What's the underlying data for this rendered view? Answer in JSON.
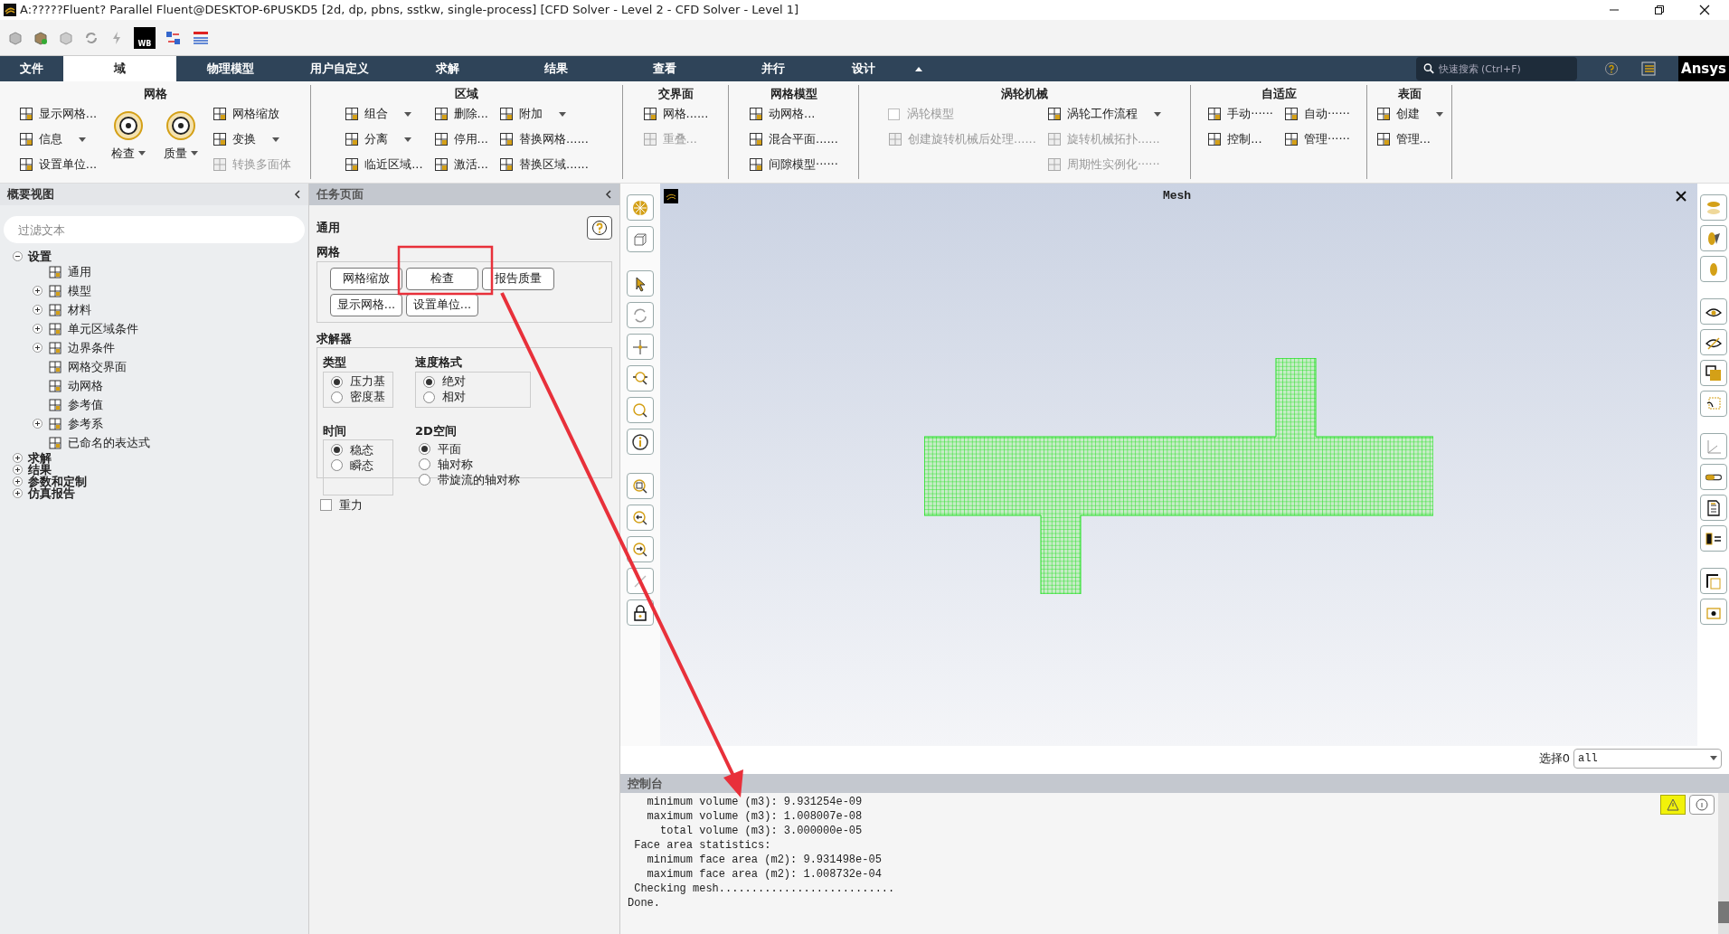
{
  "window": {
    "title": "A:?????Fluent? Parallel Fluent@DESKTOP-6PUSKD5  [2d, dp, pbns, sstkw, single-process] [CFD Solver - Level 2 - CFD Solver - Level 1]"
  },
  "quick_toolbar": {
    "wb_label": "WB"
  },
  "tabs": [
    {
      "label": "文件",
      "selected": false
    },
    {
      "label": "域",
      "selected": true
    },
    {
      "label": "物理模型",
      "selected": false
    },
    {
      "label": "用户自定义",
      "selected": false
    },
    {
      "label": "求解",
      "selected": false
    },
    {
      "label": "结果",
      "selected": false
    },
    {
      "label": "查看",
      "selected": false
    },
    {
      "label": "并行",
      "selected": false
    },
    {
      "label": "设计",
      "selected": false
    }
  ],
  "search": {
    "placeholder": "快速搜索 (Ctrl+F)"
  },
  "brand": "Ansys",
  "ribbon": [
    {
      "title": "网格",
      "columns": [
        [
          {
            "kind": "button",
            "label": "显示网格...",
            "disabled": false,
            "dropdown": false
          },
          {
            "kind": "button",
            "label": "信息",
            "disabled": false,
            "dropdown": true
          },
          {
            "kind": "button",
            "label": "设置单位...",
            "disabled": false,
            "dropdown": false
          }
        ],
        [
          {
            "kind": "large",
            "label": "检查",
            "disabled": false,
            "dropdown": true
          }
        ],
        [
          {
            "kind": "large",
            "label": "质量",
            "disabled": false,
            "dropdown": true
          }
        ],
        [
          {
            "kind": "button",
            "label": "网格缩放",
            "disabled": false,
            "dropdown": false
          },
          {
            "kind": "button",
            "label": "变换",
            "disabled": false,
            "dropdown": true
          },
          {
            "kind": "button",
            "label": "转换多面体",
            "disabled": true,
            "dropdown": false
          }
        ]
      ]
    },
    {
      "title": "区域",
      "columns": [
        [
          {
            "kind": "button",
            "label": "组合",
            "disabled": false,
            "dropdown": true
          },
          {
            "kind": "button",
            "label": "分离",
            "disabled": false,
            "dropdown": true
          },
          {
            "kind": "button",
            "label": "临近区域...",
            "disabled": false,
            "dropdown": false
          }
        ],
        [
          {
            "kind": "button",
            "label": "删除...",
            "disabled": false,
            "dropdown": false
          },
          {
            "kind": "button",
            "label": "停用...",
            "disabled": false,
            "dropdown": false
          },
          {
            "kind": "button",
            "label": "激活...",
            "disabled": false,
            "dropdown": false
          }
        ],
        [
          {
            "kind": "button",
            "label": "附加",
            "disabled": false,
            "dropdown": true
          },
          {
            "kind": "button",
            "label": "替换网格......",
            "disabled": false,
            "dropdown": false
          },
          {
            "kind": "button",
            "label": "替换区域......",
            "disabled": false,
            "dropdown": false
          }
        ]
      ]
    },
    {
      "title": "交界面",
      "columns": [
        [
          {
            "kind": "button",
            "label": "网格......",
            "disabled": false,
            "dropdown": false
          },
          {
            "kind": "button",
            "label": "重叠...",
            "disabled": true,
            "dropdown": false
          }
        ]
      ]
    },
    {
      "title": "网格模型",
      "columns": [
        [
          {
            "kind": "button",
            "label": "动网格...",
            "disabled": false,
            "dropdown": false
          },
          {
            "kind": "button",
            "label": "混合平面......",
            "disabled": false,
            "dropdown": false
          },
          {
            "kind": "button",
            "label": "间隙模型······",
            "disabled": false,
            "dropdown": false
          }
        ]
      ]
    },
    {
      "title": "涡轮机械",
      "columns": [
        [
          {
            "kind": "checkbox",
            "label": "涡轮模型",
            "disabled": true,
            "checked": false
          },
          {
            "kind": "button",
            "label": "创建旋转机械后处理......",
            "disabled": true,
            "dropdown": false
          }
        ],
        [
          {
            "kind": "button",
            "label": "涡轮工作流程",
            "disabled": false,
            "dropdown": true
          },
          {
            "kind": "button",
            "label": "旋转机械拓扑......",
            "disabled": true,
            "dropdown": false
          },
          {
            "kind": "button",
            "label": "周期性实例化······",
            "disabled": true,
            "dropdown": false
          }
        ]
      ]
    },
    {
      "title": "自适应",
      "columns": [
        [
          {
            "kind": "button",
            "label": "手动······",
            "disabled": false,
            "dropdown": false
          },
          {
            "kind": "button",
            "label": "控制...",
            "disabled": false,
            "dropdown": false
          }
        ],
        [
          {
            "kind": "button",
            "label": "自动······",
            "disabled": false,
            "dropdown": false
          },
          {
            "kind": "button",
            "label": "管理······",
            "disabled": false,
            "dropdown": false
          }
        ]
      ]
    },
    {
      "title": "表面",
      "columns": [
        [
          {
            "kind": "button",
            "label": "创建",
            "disabled": false,
            "dropdown": true
          },
          {
            "kind": "button",
            "label": "管理...",
            "disabled": false,
            "dropdown": false
          }
        ]
      ]
    }
  ],
  "outline": {
    "title": "概要视图",
    "filter_placeholder": "过滤文本",
    "tree": [
      {
        "label": "设置",
        "kind": "folder",
        "expanded": true,
        "children": [
          {
            "label": "通用",
            "kind": "leaf"
          },
          {
            "label": "模型",
            "kind": "folder",
            "expanded": false
          },
          {
            "label": "材料",
            "kind": "folder",
            "expanded": false
          },
          {
            "label": "单元区域条件",
            "kind": "folder",
            "expanded": false
          },
          {
            "label": "边界条件",
            "kind": "folder",
            "expanded": false
          },
          {
            "label": "网格交界面",
            "kind": "leaf"
          },
          {
            "label": "动网格",
            "kind": "leaf"
          },
          {
            "label": "参考值",
            "kind": "leaf"
          },
          {
            "label": "参考系",
            "kind": "folder",
            "expanded": false
          },
          {
            "label": "已命名的表达式",
            "kind": "leaf"
          }
        ]
      },
      {
        "label": "求解",
        "kind": "folder",
        "expanded": false
      },
      {
        "label": "结果",
        "kind": "folder",
        "expanded": false
      },
      {
        "label": "参数和定制",
        "kind": "folder",
        "expanded": false
      },
      {
        "label": "仿真报告",
        "kind": "folder",
        "expanded": false
      }
    ]
  },
  "task_page": {
    "header": "任务页面",
    "title": "通用",
    "mesh": {
      "title": "网格",
      "buttons": [
        "网格缩放",
        "检查",
        "报告质量",
        "显示网格...",
        "设置单位..."
      ]
    },
    "solver": {
      "title": "求解器",
      "groups": [
        {
          "title": "类型",
          "options": [
            {
              "label": "压力基",
              "selected": true
            },
            {
              "label": "密度基",
              "selected": false
            }
          ]
        },
        {
          "title": "速度格式",
          "options": [
            {
              "label": "绝对",
              "selected": true
            },
            {
              "label": "相对",
              "selected": false
            }
          ]
        },
        {
          "title": "时间",
          "options": [
            {
              "label": "稳态",
              "selected": true
            },
            {
              "label": "瞬态",
              "selected": false
            }
          ]
        },
        {
          "title": "2D空间",
          "options": [
            {
              "label": "平面",
              "selected": true
            },
            {
              "label": "轴对称",
              "selected": false
            },
            {
              "label": "带旋流的轴对称",
              "selected": false
            }
          ]
        }
      ]
    },
    "gravity": {
      "label": "重力",
      "checked": false
    }
  },
  "graphics": {
    "title": "Mesh",
    "selection_label": "选择0",
    "selection_value": "all"
  },
  "console": {
    "title": "控制台",
    "lines": [
      "   minimum volume (m3): 9.931254e-09",
      "   maximum volume (m3): 1.008007e-08",
      "     total volume (m3): 3.000000e-05",
      " Face area statistics:",
      "   minimum face area (m2): 9.931498e-05",
      "   maximum face area (m2): 1.008732e-04",
      " Checking mesh...........................",
      "Done."
    ]
  }
}
